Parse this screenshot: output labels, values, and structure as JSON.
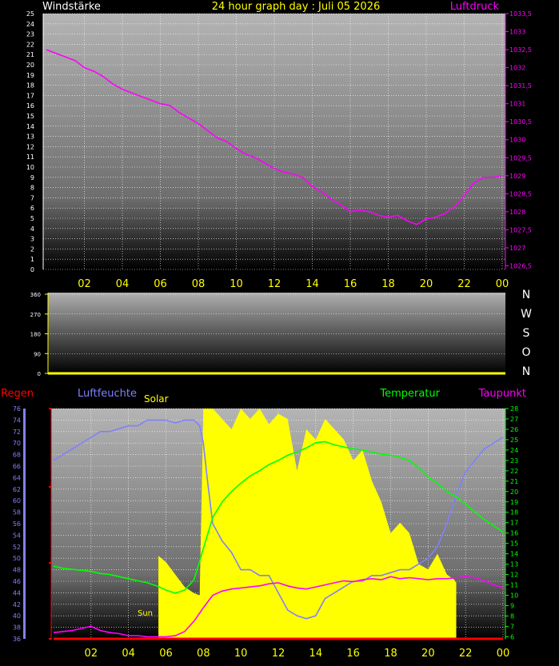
{
  "page_title": "24 hour graph day : Juli 05 2026",
  "colors": {
    "wind": "#ffffff",
    "pressure": "#ff00ff",
    "rain": "#ff0000",
    "humidity": "#8080ff",
    "solar": "#ffff00",
    "temperature": "#00ff00",
    "dewpoint": "#ff00ff",
    "time_labels": "#ffff00"
  },
  "chart_data": [
    {
      "type": "line",
      "title": "24 hour graph day : Juli 05 2026",
      "left_axis_label": "Windstärke",
      "right_axis_label": "Luftdruck",
      "x_tick_labels": [
        "02",
        "04",
        "06",
        "08",
        "10",
        "12",
        "14",
        "16",
        "18",
        "20",
        "22",
        "00"
      ],
      "y_left_ticks": [
        "0",
        "1",
        "2",
        "3",
        "4",
        "5",
        "6",
        "7",
        "8",
        "9",
        "10",
        "11",
        "12",
        "13",
        "14",
        "15",
        "16",
        "17",
        "18",
        "19",
        "20",
        "21",
        "22",
        "23",
        "24",
        "25"
      ],
      "y_left_lim": [
        0,
        25
      ],
      "y_right_ticks": [
        "1026,5",
        "1027",
        "1027,5",
        "1028",
        "1028,5",
        "1029",
        "1029,5",
        "1030",
        "1030,5",
        "1031",
        "1031,5",
        "1032",
        "1032,5",
        "1033",
        "1033,5"
      ],
      "y_right_lim": [
        1026.4,
        1033.5
      ],
      "grid": true,
      "series": [
        {
          "name": "Luftdruck",
          "axis": "right",
          "x_hours": [
            0,
            0.5,
            1,
            1.5,
            2,
            2.5,
            3,
            3.5,
            4,
            4.5,
            5,
            5.5,
            6,
            6.5,
            7,
            7.5,
            8,
            8.5,
            9,
            9.5,
            10,
            10.5,
            11,
            11.5,
            12,
            12.5,
            13,
            13.5,
            14,
            14.5,
            15,
            15.5,
            16,
            16.5,
            17,
            17.5,
            18,
            18.5,
            19,
            19.5,
            20,
            20.5,
            21,
            21.5,
            22,
            22.5,
            23,
            23.5,
            24
          ],
          "values": [
            1032.5,
            1032.4,
            1032.3,
            1032.2,
            1032.0,
            1031.9,
            1031.75,
            1031.55,
            1031.4,
            1031.3,
            1031.2,
            1031.1,
            1031.0,
            1030.95,
            1030.75,
            1030.6,
            1030.45,
            1030.25,
            1030.05,
            1029.95,
            1029.75,
            1029.6,
            1029.5,
            1029.35,
            1029.2,
            1029.1,
            1029.05,
            1028.95,
            1028.7,
            1028.55,
            1028.35,
            1028.2,
            1028.0,
            1028.05,
            1028.0,
            1027.9,
            1027.85,
            1027.9,
            1027.75,
            1027.65,
            1027.8,
            1027.85,
            1027.95,
            1028.15,
            1028.45,
            1028.8,
            1028.95,
            1028.95,
            1029.0
          ]
        }
      ]
    },
    {
      "type": "line",
      "title": "",
      "y_left_ticks": [
        "0",
        "90",
        "180",
        "270",
        "360"
      ],
      "y_left_lim": [
        0,
        360
      ],
      "direction_labels": [
        "N",
        "W",
        "S",
        "O",
        "N"
      ],
      "grid": true,
      "series": []
    },
    {
      "type": "area",
      "title": "",
      "legend": [
        "Regen",
        "Luftfeuchte",
        "Solar",
        "Temperatur",
        "Taupunkt"
      ],
      "x_tick_labels": [
        "02",
        "04",
        "06",
        "08",
        "10",
        "12",
        "14",
        "16",
        "18",
        "20",
        "22",
        "00"
      ],
      "y_left_ticks": [
        "36",
        "38",
        "40",
        "42",
        "44",
        "46",
        "48",
        "50",
        "52",
        "54",
        "56",
        "58",
        "60",
        "62",
        "64",
        "66",
        "68",
        "70",
        "72",
        "74",
        "76"
      ],
      "y_left_lim": [
        36,
        76
      ],
      "y_right_ticks": [
        "6",
        "7",
        "8",
        "9",
        "10",
        "11",
        "12",
        "13",
        "14",
        "15",
        "16",
        "17",
        "18",
        "19",
        "20",
        "21",
        "22",
        "23",
        "24",
        "25",
        "26",
        "27",
        "28"
      ],
      "y_right_lim": [
        5.8,
        28
      ],
      "annotations": [
        "Sun"
      ],
      "grid": true,
      "series": [
        {
          "name": "Luftfeuchte",
          "axis": "left",
          "x_hours": [
            0,
            0.5,
            1,
            1.5,
            2,
            2.5,
            3,
            3.5,
            4,
            4.5,
            5,
            5.5,
            6,
            6.5,
            7,
            7.5,
            7.8,
            8,
            8.2,
            8.5,
            9,
            9.5,
            10,
            10.5,
            11,
            11.5,
            12,
            12.5,
            13,
            13.5,
            14,
            14.5,
            15,
            15.5,
            16,
            16.5,
            17,
            17.5,
            18,
            18.5,
            19,
            19.5,
            20,
            20.5,
            21,
            21.5,
            22,
            22.5,
            23,
            23.5,
            24
          ],
          "values": [
            67,
            68,
            69,
            70,
            71,
            72,
            72,
            72.5,
            73,
            73,
            74,
            74,
            74,
            73.5,
            74,
            74,
            73,
            70,
            64,
            56,
            53,
            51,
            48,
            48,
            47,
            47,
            44,
            41,
            40,
            39.5,
            40,
            43,
            44,
            45,
            46,
            46,
            47,
            47,
            47.5,
            48,
            48,
            49,
            50,
            52,
            56,
            61,
            65,
            67,
            69,
            70,
            71
          ]
        },
        {
          "name": "Temperatur",
          "axis": "right",
          "x_hours": [
            0,
            0.5,
            1,
            1.5,
            2,
            2.5,
            3,
            3.5,
            4,
            4.5,
            5,
            5.5,
            6,
            6.5,
            7,
            7.5,
            8,
            8.5,
            9,
            9.5,
            10,
            10.5,
            11,
            11.5,
            12,
            12.5,
            13,
            13.5,
            14,
            14.5,
            15,
            15.5,
            16,
            16.5,
            17,
            17.5,
            18,
            18.5,
            19,
            19.5,
            20,
            20.5,
            21,
            21.5,
            22,
            22.5,
            23,
            23.5,
            24
          ],
          "values": [
            12.8,
            12.6,
            12.5,
            12.4,
            12.3,
            12.1,
            12.0,
            11.8,
            11.6,
            11.4,
            11.2,
            10.9,
            10.5,
            10.2,
            10.5,
            11.5,
            14.5,
            17.5,
            19.0,
            20.0,
            20.8,
            21.5,
            22.0,
            22.6,
            23.0,
            23.5,
            23.8,
            24.2,
            24.7,
            24.8,
            24.5,
            24.3,
            24.1,
            24.0,
            23.8,
            23.6,
            23.5,
            23.3,
            23.0,
            22.3,
            21.4,
            20.8,
            20.0,
            19.5,
            18.8,
            18.0,
            17.3,
            16.7,
            16.1,
            15.6,
            15.0
          ]
        },
        {
          "name": "Taupunkt",
          "axis": "right",
          "x_hours": [
            0,
            0.5,
            1,
            1.5,
            2,
            2.5,
            3,
            3.5,
            4,
            4.5,
            5,
            5.5,
            6,
            6.5,
            7,
            7.5,
            8,
            8.5,
            9,
            9.5,
            10,
            10.5,
            11,
            11.5,
            12,
            12.5,
            13,
            13.5,
            14,
            14.5,
            15,
            15.5,
            16,
            16.5,
            17,
            17.5,
            18,
            18.5,
            19,
            19.5,
            20,
            20.5,
            21,
            21.5,
            22,
            22.5,
            23,
            23.5,
            24
          ],
          "values": [
            6.4,
            6.5,
            6.6,
            6.8,
            7.0,
            6.6,
            6.4,
            6.3,
            6.1,
            6.1,
            6.0,
            6.0,
            6.0,
            6.1,
            6.5,
            7.5,
            8.8,
            10.0,
            10.4,
            10.6,
            10.7,
            10.8,
            10.9,
            11.1,
            11.2,
            10.9,
            10.7,
            10.6,
            10.8,
            11.0,
            11.2,
            11.4,
            11.3,
            11.5,
            11.6,
            11.5,
            11.8,
            11.6,
            11.7,
            11.6,
            11.5,
            11.6,
            11.6,
            11.7,
            11.8,
            11.7,
            11.4,
            11.0,
            10.7,
            10.3,
            10.0
          ]
        },
        {
          "name": "Solar",
          "axis": "right",
          "x_hours": [
            5.6,
            6,
            6.5,
            7,
            7.5,
            7.8,
            8,
            8.5,
            9,
            9.5,
            10,
            10.5,
            11,
            11.5,
            12,
            12.5,
            13,
            13.5,
            14,
            14.5,
            15,
            15.5,
            16,
            16.5,
            17,
            17.5,
            18,
            18.5,
            19,
            19.5,
            20,
            20.5,
            21,
            21.4,
            21.5
          ],
          "values": [
            13.8,
            13.2,
            12.0,
            10.8,
            10.2,
            10.0,
            28.0,
            28.0,
            27.0,
            26.0,
            28.0,
            27.0,
            28.0,
            26.5,
            27.5,
            27.0,
            22.0,
            26.0,
            25.0,
            27.0,
            26.0,
            25.0,
            23.0,
            24.0,
            21.0,
            19.0,
            16.0,
            17.0,
            16.0,
            13.0,
            12.5,
            14.0,
            12.0,
            11.5,
            11.2
          ]
        },
        {
          "name": "Regen",
          "axis": "left",
          "x_hours": [
            0,
            24
          ],
          "values": [
            36,
            36
          ]
        }
      ]
    }
  ]
}
